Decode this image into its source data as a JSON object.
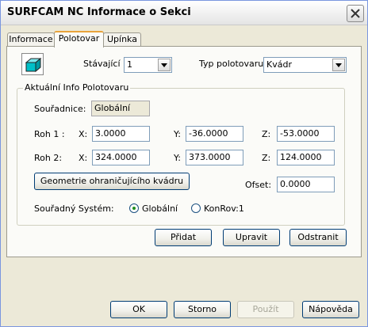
{
  "window": {
    "title": "SURFCAM NC Informace o Sekci",
    "icon": "close-icon"
  },
  "tabs": [
    {
      "label": "Informace",
      "active": false
    },
    {
      "label": "Polotovar",
      "active": true
    },
    {
      "label": "Upínka",
      "active": false
    }
  ],
  "stock": {
    "icon": "box-stock-icon",
    "current_label": "Stávající",
    "current_value": "1",
    "type_label": "Typ polotovaru:",
    "type_value": "Kvádr"
  },
  "info": {
    "group_title": "Aktuální Info Polotovaru",
    "coords_label": "Souřadnice:",
    "coords_value": "Globální",
    "corner1": {
      "label": "Roh 1 :",
      "x_label": "X:",
      "x": "3.0000",
      "y_label": "Y:",
      "y": "-36.0000",
      "z_label": "Z:",
      "z": "-53.0000"
    },
    "corner2": {
      "label": "Roh 2:",
      "x_label": "X:",
      "x": "324.0000",
      "y_label": "Y:",
      "y": "373.0000",
      "z_label": "Z:",
      "z": "124.0000"
    },
    "bbox_button": "Geometrie ohraničujícího kvádru",
    "offset_label": "Ofset:",
    "offset_value": "0.0000",
    "system_label": "Souřadný Systém:",
    "radio_global": "Globální",
    "radio_konrov": "KonRov:1",
    "selected": "Globální"
  },
  "actions": {
    "add": "Přidat",
    "edit": "Upravit",
    "remove": "Odstranit"
  },
  "footer": {
    "ok": "OK",
    "cancel": "Storno",
    "apply": "Použít",
    "help": "Nápověda"
  },
  "colors": {
    "window_bg": "#ece9d8",
    "panel_bg": "#fbfbf8",
    "tab_highlight": "#e9a33b",
    "icon_teal": "#00c0c8"
  }
}
